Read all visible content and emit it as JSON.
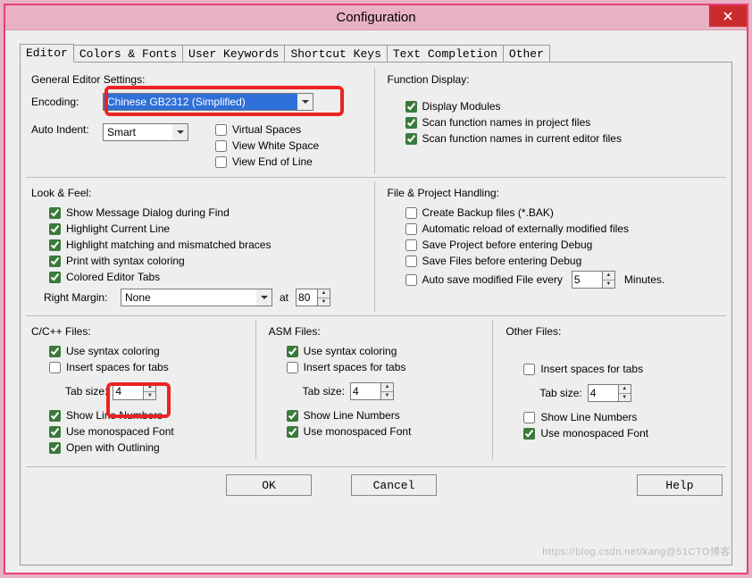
{
  "window": {
    "title": "Configuration"
  },
  "tabs": [
    "Editor",
    "Colors & Fonts",
    "User Keywords",
    "Shortcut Keys",
    "Text Completion",
    "Other"
  ],
  "general": {
    "heading": "General Editor Settings:",
    "encoding_label": "Encoding:",
    "encoding_value": "Chinese GB2312 (Simplified)",
    "auto_indent_label": "Auto Indent:",
    "auto_indent_value": "Smart",
    "virtual_spaces": "Virtual Spaces",
    "view_white_space": "View White Space",
    "view_end_of_line": "View End of Line"
  },
  "function_display": {
    "heading": "Function Display:",
    "display_modules": "Display Modules",
    "scan_project": "Scan function names in project files",
    "scan_editor": "Scan function names in current editor files"
  },
  "look_feel": {
    "heading": "Look & Feel:",
    "show_message": "Show Message Dialog during Find",
    "highlight_line": "Highlight Current Line",
    "highlight_braces": "Highlight matching and mismatched braces",
    "print_syntax": "Print with syntax coloring",
    "colored_tabs": "Colored Editor Tabs",
    "right_margin_label": "Right Margin:",
    "right_margin_value": "None",
    "at_label": "at",
    "at_value": "80"
  },
  "file_handling": {
    "heading": "File & Project Handling:",
    "backup": "Create Backup files (*.BAK)",
    "auto_reload": "Automatic reload of externally modified files",
    "save_project": "Save Project before entering Debug",
    "save_files": "Save Files before entering Debug",
    "auto_save": "Auto save modified File every",
    "auto_save_value": "5",
    "minutes": "Minutes."
  },
  "c_files": {
    "heading": "C/C++ Files:",
    "syntax": "Use syntax coloring",
    "spaces": "Insert spaces for tabs",
    "tab_label": "Tab size:",
    "tab_value": "4",
    "line_numbers": "Show Line Numbers",
    "mono": "Use monospaced Font",
    "outlining": "Open with Outlining"
  },
  "asm_files": {
    "heading": "ASM Files:",
    "syntax": "Use syntax coloring",
    "spaces": "Insert spaces for tabs",
    "tab_label": "Tab size:",
    "tab_value": "4",
    "line_numbers": "Show Line Numbers",
    "mono": "Use monospaced Font"
  },
  "other_files": {
    "heading": "Other Files:",
    "spaces": "Insert spaces for tabs",
    "tab_label": "Tab size:",
    "tab_value": "4",
    "line_numbers": "Show Line Numbers",
    "mono": "Use monospaced Font"
  },
  "buttons": {
    "ok": "OK",
    "cancel": "Cancel",
    "help": "Help"
  },
  "watermark": "https://blog.csdn.net/kang@51CTO博客"
}
